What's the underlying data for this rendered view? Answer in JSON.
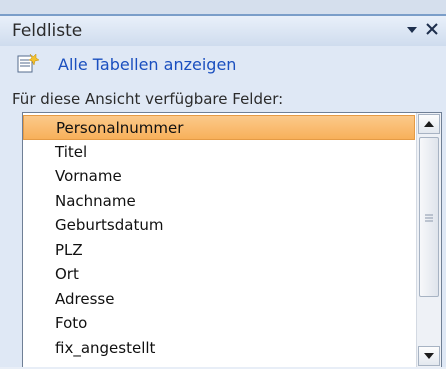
{
  "pane": {
    "title": "Feldliste",
    "show_all_label": "Alle Tabellen anzeigen",
    "available_label": "Für diese Ansicht verfügbare Felder:"
  },
  "fields": [
    {
      "label": "Personalnummer",
      "selected": true
    },
    {
      "label": "Titel"
    },
    {
      "label": "Vorname"
    },
    {
      "label": "Nachname"
    },
    {
      "label": "Geburtsdatum"
    },
    {
      "label": "PLZ"
    },
    {
      "label": "Ort"
    },
    {
      "label": "Adresse"
    },
    {
      "label": "Foto"
    },
    {
      "label": "fix_angestellt"
    }
  ],
  "icons": {
    "dropdown": "chevron-down-icon",
    "close": "close-icon",
    "show_all": "table-wizard-icon"
  }
}
